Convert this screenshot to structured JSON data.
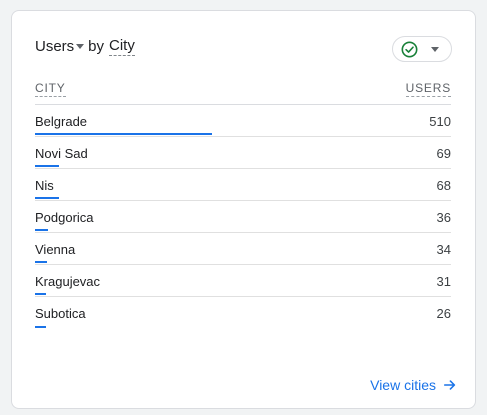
{
  "card": {
    "metric_label": "Users",
    "by_label": "by",
    "dimension_label": "City",
    "status_color": "#188038"
  },
  "table": {
    "col_city": "CITY",
    "col_users": "USERS",
    "rows": [
      {
        "city": "Belgrade",
        "users": "510",
        "share": 1.0
      },
      {
        "city": "Novi Sad",
        "users": "69",
        "share": 0.135
      },
      {
        "city": "Nis",
        "users": "68",
        "share": 0.133
      },
      {
        "city": "Podgorica",
        "users": "36",
        "share": 0.071
      },
      {
        "city": "Vienna",
        "users": "34",
        "share": 0.067
      },
      {
        "city": "Kragujevac",
        "users": "31",
        "share": 0.061
      },
      {
        "city": "Subotica",
        "users": "26",
        "share": 0.051
      }
    ]
  },
  "footer": {
    "link_label": "View cities"
  },
  "colors": {
    "accent": "#1a73e8",
    "text": "#202124",
    "muted": "#5f6368"
  }
}
